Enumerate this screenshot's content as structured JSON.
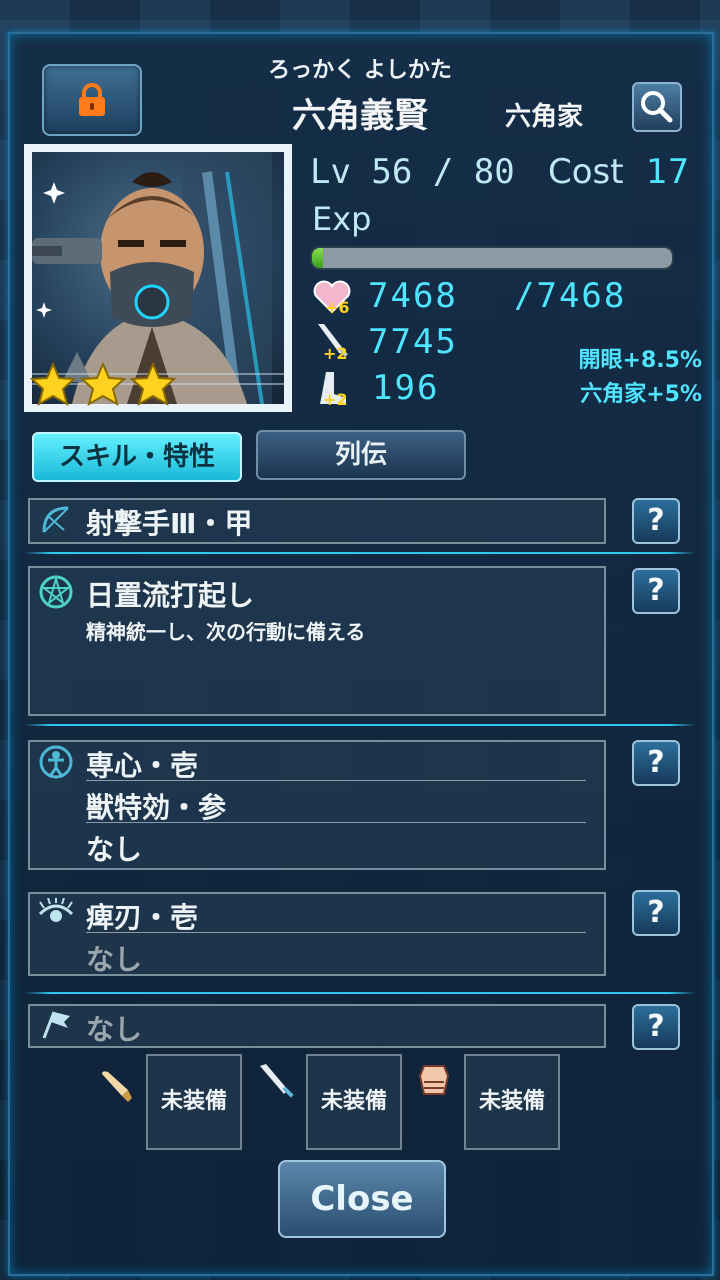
{
  "header": {
    "kana": "ろっかく よしかた",
    "name": "六角義賢",
    "clan": "六角家"
  },
  "stats": {
    "lv_label": "Lv 56 / 80",
    "cost_label": "Cost",
    "cost_value": "17",
    "exp_label": "Exp",
    "exp_fraction": 0.03,
    "hp_bonus": "+6",
    "hp_current": "7468",
    "hp_max": "/7468",
    "atk_bonus": "+2",
    "atk": "7745",
    "def_bonus": "+2",
    "def": "196",
    "bonus_1": "開眼+8.5%",
    "bonus_2": "六角家+5%"
  },
  "portrait": {
    "stars": 3
  },
  "tabs": {
    "skill": "スキル・特性",
    "bio": "列伝"
  },
  "skills": {
    "class_name": "射撃手Ⅲ・甲",
    "active_name": "日置流打起し",
    "active_desc": "精神統一し、次の行動に備える",
    "passive_1": "専心・壱",
    "passive_2": "獣特効・参",
    "passive_3": "なし",
    "awaken_1": "痺刃・壱",
    "awaken_2": "なし",
    "flag": "なし",
    "help": "?"
  },
  "equipment": {
    "slot1": "未装備",
    "slot2": "未装備",
    "slot3": "未装備"
  },
  "close_label": "Close",
  "colors": {
    "accent": "#4fe4ff",
    "panel": "#142d46",
    "lock": "#ff7a1a"
  }
}
